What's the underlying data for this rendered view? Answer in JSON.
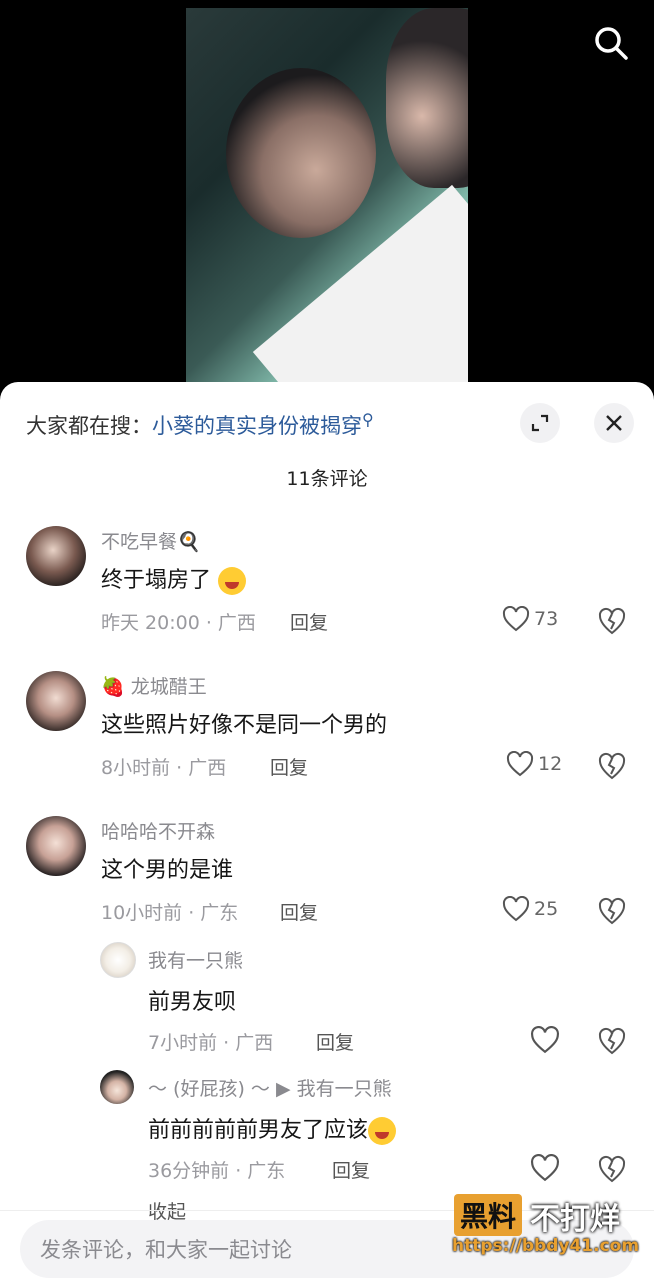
{
  "header": {
    "hot_prefix": "大家都在搜：",
    "hot_link": "小葵的真实身份被揭穿",
    "comment_count": "11条评论"
  },
  "comments": [
    {
      "name": "不吃早餐🍳",
      "text": "终于塌房了",
      "time": "昨天 20:00 · 广西",
      "reply": "回复",
      "likes": "73"
    },
    {
      "name": "🍓 龙城醋王",
      "text": "这些照片好像不是同一个男的",
      "time": "8小时前 · 广西",
      "reply": "回复",
      "likes": "12"
    },
    {
      "name": "哈哈哈不开森",
      "text": "这个男的是谁",
      "time": "10小时前 · 广东",
      "reply": "回复",
      "likes": "25"
    }
  ],
  "replies": [
    {
      "name": "我有一只熊",
      "text": "前男友呗",
      "time": "7小时前 · 广西",
      "reply": "回复"
    },
    {
      "name": "～ (好屁孩) ～ ▶ 我有一只熊",
      "text": "前前前前前男友了应该",
      "time": "36分钟前 · 广东",
      "reply": "回复"
    }
  ],
  "collapse_label": "收起",
  "input": {
    "placeholder": "发条评论，和大家一起讨论"
  },
  "watermark": {
    "brand": "黑料",
    "slogan": "不打烊",
    "url": "https://bbdy41.com"
  },
  "icons": [
    "search-icon",
    "expand-icon",
    "close-icon",
    "heart-icon",
    "broken-heart-icon",
    "laughing-emoji",
    "cry-laugh-emoji"
  ]
}
